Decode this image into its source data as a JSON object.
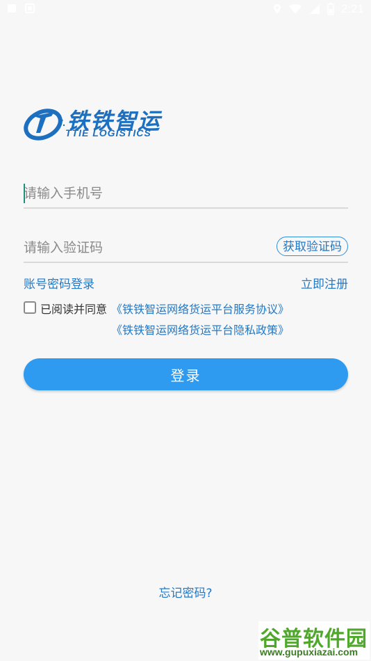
{
  "status_bar": {
    "time": "2:21",
    "icons": [
      "notification-square-icon",
      "notification-square-icon",
      "location-icon",
      "wifi-icon",
      "cellular-icon",
      "battery-icon"
    ]
  },
  "logo": {
    "cn": "铁铁智运",
    "en": "TTIE LOGISTICS"
  },
  "form": {
    "phone_placeholder": "请输入手机号",
    "code_placeholder": "请输入验证码",
    "get_code_label": "获取验证码"
  },
  "links": {
    "password_login": "账号密码登录",
    "register": "立即注册"
  },
  "agreement": {
    "checked": false,
    "label": "已阅读并同意",
    "service_agreement": "《铁铁智运网络货运平台服务协议》",
    "privacy_policy": "《铁铁智运网络货运平台隐私政策》"
  },
  "login_label": "登录",
  "forgot_password": "忘记密码?",
  "watermark": {
    "cn": "谷普软件园",
    "en": "www.gupuxiazai.com"
  },
  "colors": {
    "accent": "#2f9bf0",
    "link": "#2378c6",
    "brand": "#1d6fc0",
    "background": "#f7f7f7"
  }
}
